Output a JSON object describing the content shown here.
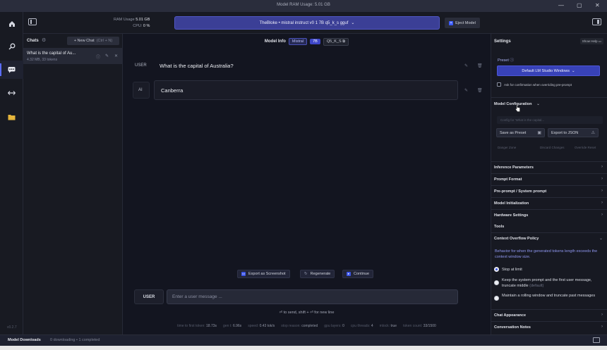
{
  "window": {
    "title": "Model RAM Usage: 5.01 GB",
    "controls": [
      "minimize",
      "maximize",
      "close"
    ]
  },
  "topbar": {
    "ram_label": "RAM Usage",
    "ram_value": "5.01 GB",
    "cpu_label": "CPU:",
    "cpu_value": "0 %",
    "model_label": "TheBloke • mistral instruct v0 1 7B q5_k_s gguf",
    "eject_label": "Eject Model"
  },
  "nav": {
    "icons": [
      "home-icon",
      "search-icon",
      "chat-icon",
      "arrows-icon",
      "folder-icon"
    ],
    "active": "chat-icon",
    "version": "v0.2.7"
  },
  "chats": {
    "title": "Chats",
    "new_chat_label": "+ New Chat",
    "new_chat_shortcut": "(Ctrl + N)",
    "items": [
      {
        "title": "What is the capital of Au...",
        "meta": "4.32 MB, 33 tokens"
      }
    ]
  },
  "model_info": {
    "label": "Model Info",
    "tags": [
      "Mistral",
      "7B",
      "Q5_K_S"
    ]
  },
  "messages": [
    {
      "role": "USER",
      "text": "What is the capital of Australia?"
    },
    {
      "role": "AI",
      "text": "Canberra"
    }
  ],
  "actions": {
    "screenshot": "Export as Screenshot",
    "regenerate": "Regenerate",
    "continue": "Continue"
  },
  "composer": {
    "role": "USER",
    "placeholder": "Enter a user message ...",
    "hint": "⏎ to send, shift + ⏎ for new line"
  },
  "stats": [
    {
      "label": "time to first token:",
      "value": "18.73s"
    },
    {
      "label": "gen t:",
      "value": "6.96s"
    },
    {
      "label": "speed:",
      "value": "0.43 tok/s"
    },
    {
      "label": "stop reason:",
      "value": "completed"
    },
    {
      "label": "gpu layers:",
      "value": "0"
    },
    {
      "label": "cpu threads:",
      "value": "4"
    },
    {
      "label": "mlock:",
      "value": "true"
    },
    {
      "label": "token count:",
      "value": "33/1500"
    }
  ],
  "settings": {
    "title": "Settings",
    "show_help": "Show Help",
    "preset_label": "Preset",
    "preset_value": "Default LM Studio Windows",
    "confirm_label": "Ask for confirmation when overriding pre-prompt",
    "model_config": "Model Configuration",
    "config_placeholder": "Config for 'What is the capital...",
    "save_preset": "Save as Preset",
    "export_json": "Export to JSON",
    "mini": [
      "Danger Zone",
      "Discard Changes",
      "Override Reset"
    ],
    "sections": [
      "Inference Parameters",
      "Prompt Format",
      "Pre-prompt / System prompt",
      "Model Initialization",
      "Hardware Settings"
    ],
    "tools_label": "Tools",
    "context_policy": "Context Overflow Policy",
    "context_desc": "Behavior for when the generated tokens length exceeds the context window size.",
    "options": [
      {
        "label": "Stop at limit",
        "extra": ""
      },
      {
        "label": "Keep the system prompt and the first user message, truncate middle",
        "extra": "(default)"
      },
      {
        "label": "Maintain a rolling window and truncate past messages",
        "extra": ""
      }
    ],
    "bottom_sections": [
      "Chat Appearance",
      "Conversation Notes"
    ]
  },
  "statusbar": {
    "downloads": "Model Downloads",
    "progress": "0 downloading • 1 completed"
  }
}
